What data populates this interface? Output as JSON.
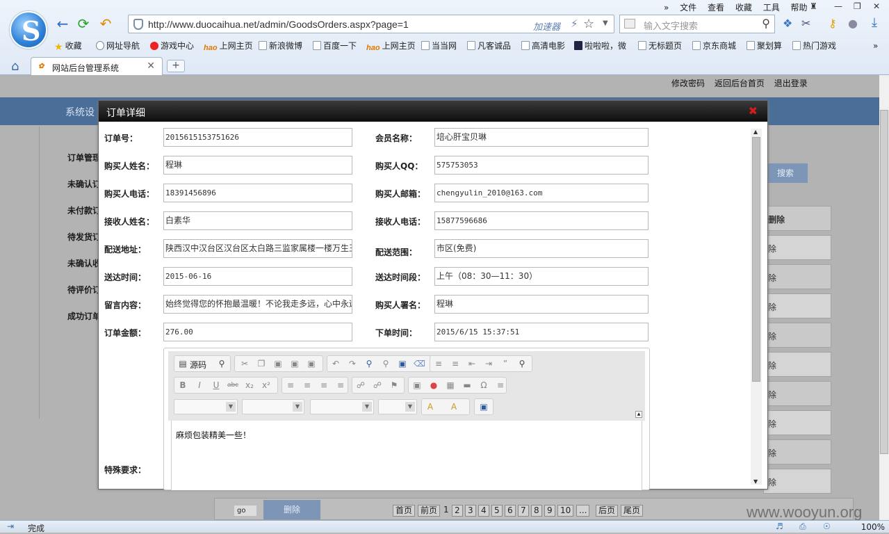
{
  "browser": {
    "url": "http://www.duocaihua.net/admin/GoodsOrders.aspx?page=1",
    "accelerator": "加速器",
    "search_placeholder": "输入文字搜索",
    "menu": [
      "文件",
      "查看",
      "收藏",
      "工具",
      "帮助"
    ],
    "favorites": [
      "收藏",
      "网址导航",
      "游戏中心",
      "上网主页",
      "新浪微博",
      "百度一下",
      "上网主页",
      "当当网",
      "凡客诚品",
      "高清电影",
      "啦啦啦，微",
      "无标题页",
      "京东商城",
      "聚划算",
      "热门游戏"
    ],
    "tab_title": "网站后台管理系统",
    "status": "完成",
    "zoom": "100%"
  },
  "page": {
    "top_links": [
      "修改密码",
      "返回后台首页",
      "退出登录"
    ],
    "bar_title": "系统设",
    "sidebar": [
      "订单管理",
      "未确认订",
      "未付款订",
      "待发货订",
      "未确认收",
      "待评价订",
      "成功订单"
    ],
    "search_button": "搜索",
    "row_delete": "除",
    "row_delete_header": "删除",
    "go_text": "go",
    "delete_button": "删除",
    "pager": [
      "首页",
      "前页",
      "1",
      "2",
      "3",
      "4",
      "5",
      "6",
      "7",
      "8",
      "9",
      "10",
      "...",
      "后页",
      "尾页"
    ]
  },
  "modal": {
    "title": "订单详细",
    "fields_left": [
      {
        "label": "订单号：",
        "value": "2015615153751626"
      },
      {
        "label": "购买人姓名：",
        "value": "程琳"
      },
      {
        "label": "购买人电话：",
        "value": "18391456896"
      },
      {
        "label": "接收人姓名：",
        "value": "白素华"
      },
      {
        "label": "配送地址：",
        "value": "陕西汉中汉台区汉台区太白路三监家属楼一楼万生王"
      },
      {
        "label": "送达时间：",
        "value": "2015-06-16"
      },
      {
        "label": "留言内容：",
        "value": "始终觉得您的怀抱最温暖！不论我走多远，心中永远"
      },
      {
        "label": "订单金额：",
        "value": "276.00"
      }
    ],
    "fields_right": [
      {
        "label": "会员名称：",
        "value": "培心肝宝贝琳"
      },
      {
        "label": "购买人QQ：",
        "value": "575753053"
      },
      {
        "label": "购买人邮箱：",
        "value": "chengyulin_2010@163.com"
      },
      {
        "label": "接收人电话：",
        "value": "15877596686"
      },
      {
        "label": "配送范围：",
        "value": "市区(免费)"
      },
      {
        "label": "送达时间段：",
        "value": "上午（08：30—11：30）"
      },
      {
        "label": "购买人署名：",
        "value": "程琳"
      },
      {
        "label": "下单时间：",
        "value": "2015/6/15 15:37:51"
      }
    ],
    "special_label": "特殊要求：",
    "editor": {
      "source_label": "源码",
      "content": "麻烦包装精美一些！"
    }
  },
  "watermark": "www.wooyun.org"
}
